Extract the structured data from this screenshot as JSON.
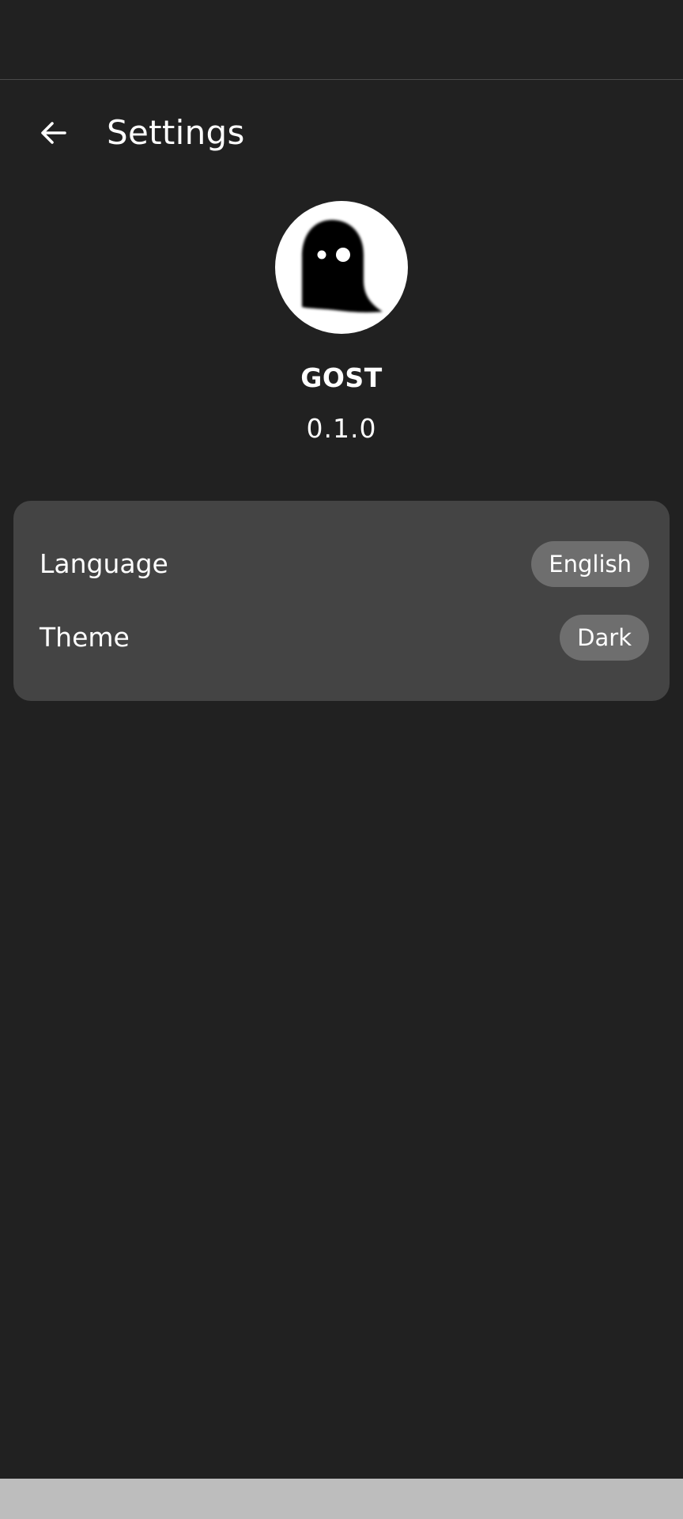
{
  "header": {
    "title": "Settings",
    "back_icon": "arrow-left-icon"
  },
  "app": {
    "logo_icon": "ghost-icon",
    "name": "GOST",
    "version": "0.1.0"
  },
  "settings": {
    "items": [
      {
        "label": "Language",
        "value": "English"
      },
      {
        "label": "Theme",
        "value": "Dark"
      }
    ]
  },
  "colors": {
    "background": "#212121",
    "card": "#444444",
    "chip": "#6e6e6e",
    "text": "#ffffff",
    "nav_bar": "#bdbdbd"
  }
}
